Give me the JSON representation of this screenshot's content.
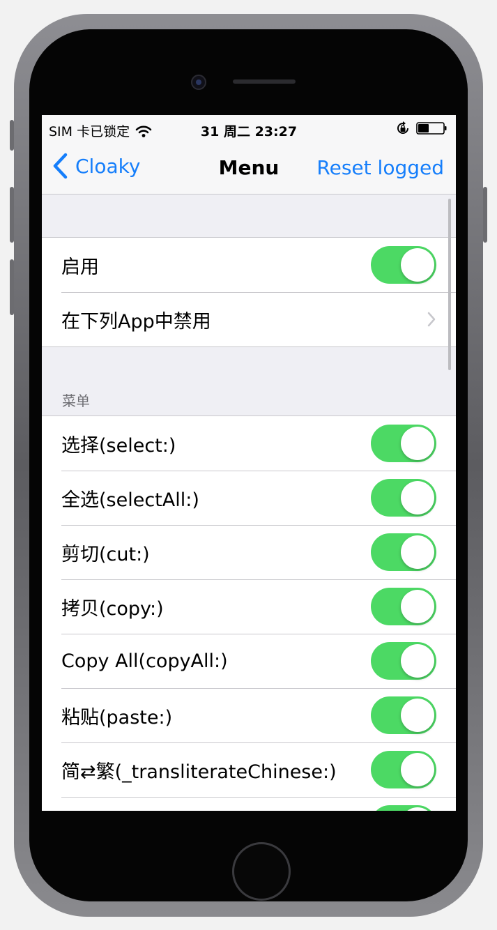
{
  "status_bar": {
    "carrier": "SIM 卡已锁定",
    "time": "31 周二 23:27"
  },
  "nav": {
    "back_label": "Cloaky",
    "title": "Menu",
    "right_button": "Reset logged"
  },
  "group1": {
    "rows": [
      {
        "label": "启用",
        "control": "switch",
        "on": true
      },
      {
        "label": "在下列App中禁用",
        "control": "chevron"
      }
    ]
  },
  "menu_section": {
    "header": "菜单",
    "rows": [
      {
        "label": "选择(select:)",
        "on": true
      },
      {
        "label": "全选(selectAll:)",
        "on": true
      },
      {
        "label": "剪切(cut:)",
        "on": true
      },
      {
        "label": "拷贝(copy:)",
        "on": true
      },
      {
        "label": "Copy All(copyAll:)",
        "on": true
      },
      {
        "label": "粘贴(paste:)",
        "on": true
      },
      {
        "label": "简⇄繁(_transliterateChinese:)",
        "on": true
      }
    ]
  },
  "colors": {
    "accent": "#157efb",
    "switch_on": "#4cd964",
    "background": "#efeff4"
  },
  "icons": [
    "wifi-icon",
    "rotation-lock-icon",
    "battery-icon",
    "chevron-left-icon",
    "chevron-right-icon"
  ]
}
